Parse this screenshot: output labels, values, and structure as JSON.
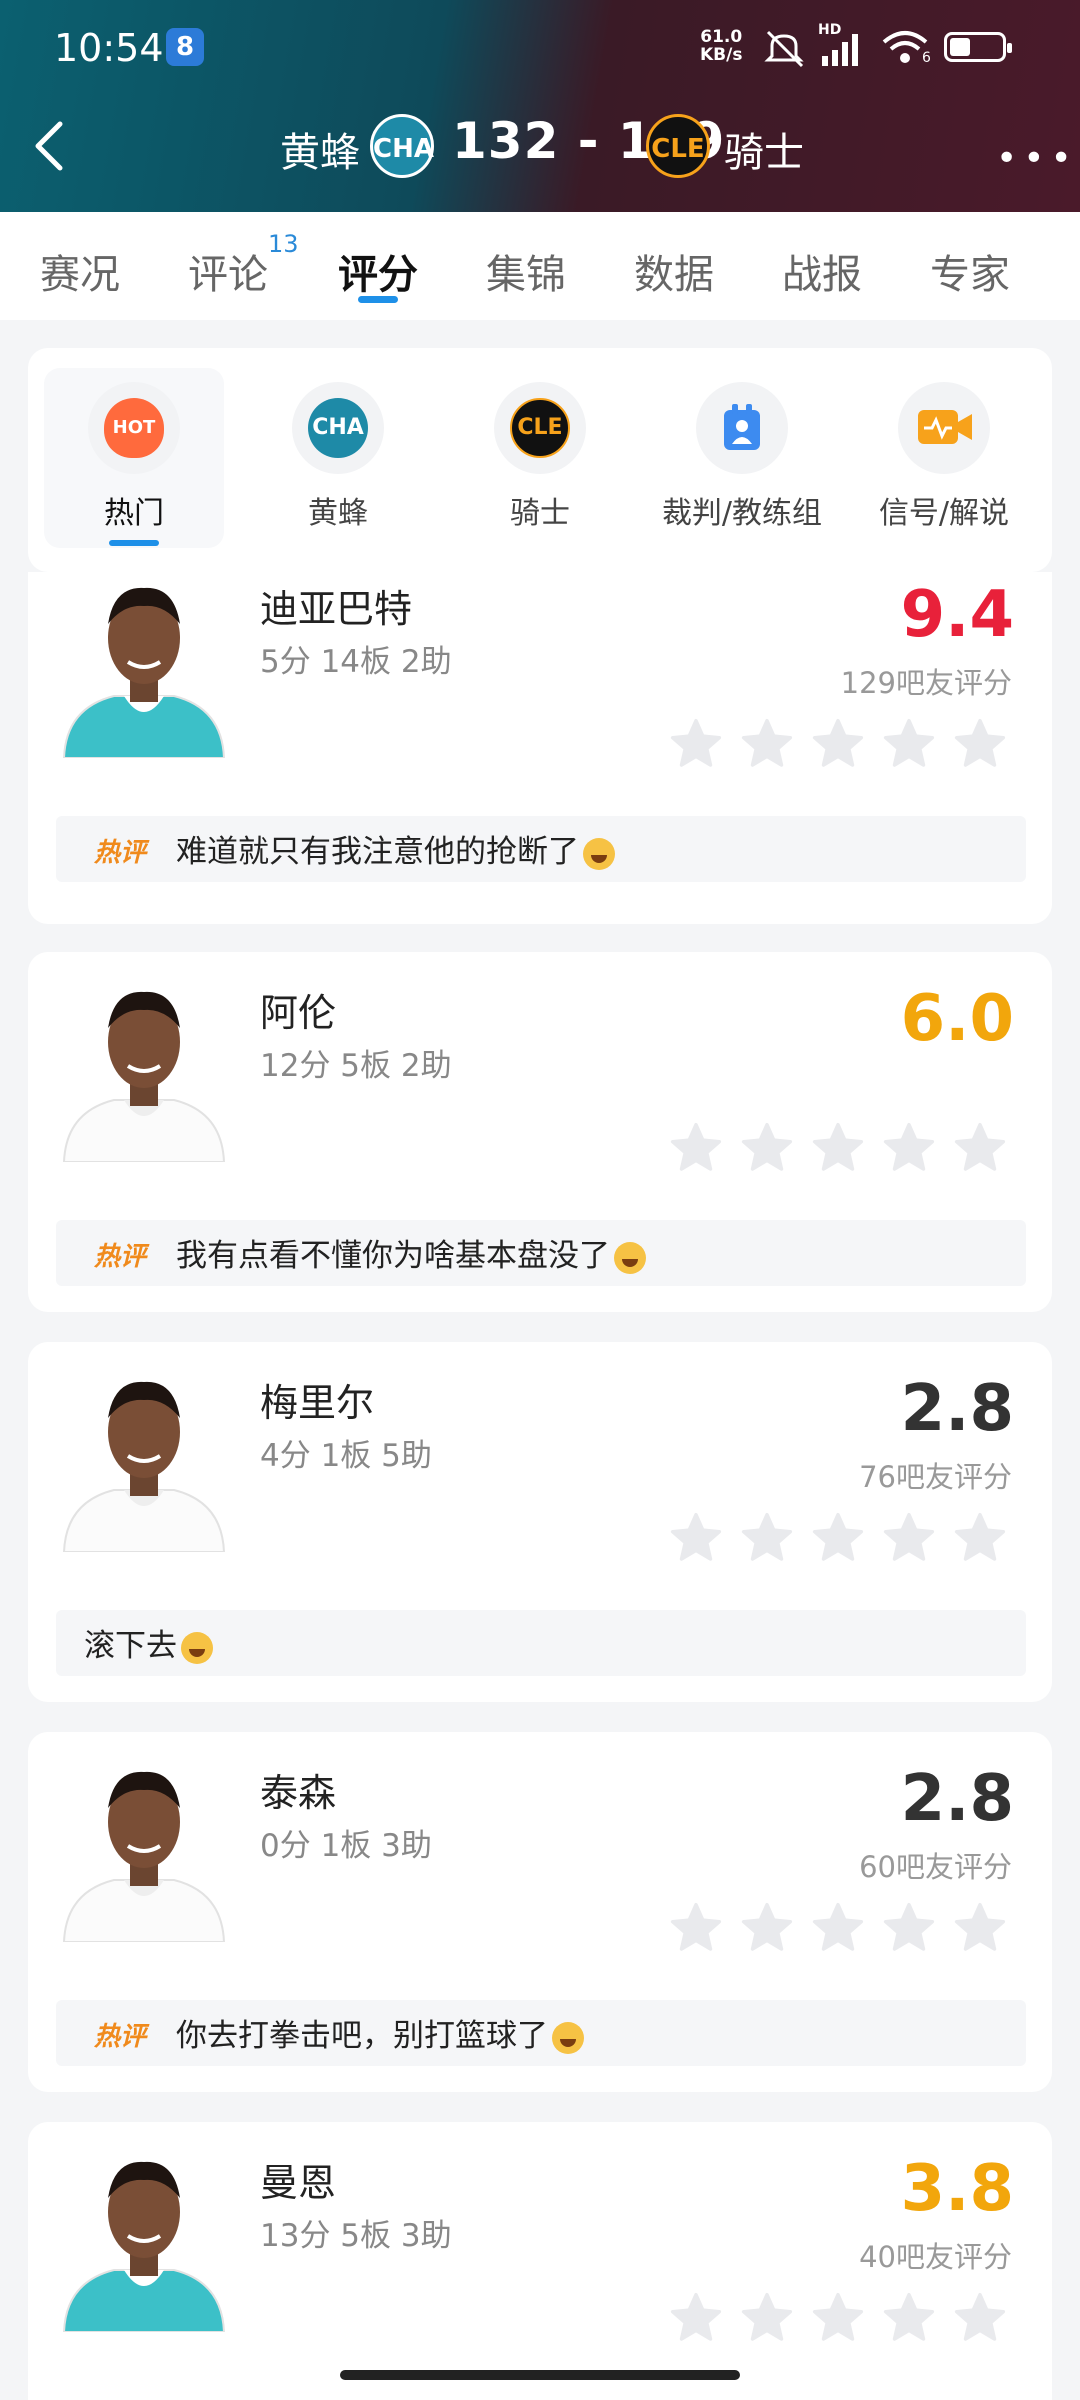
{
  "status_bar": {
    "time": "10:54",
    "notif_badge": "8",
    "speed_value": "61.0",
    "speed_unit": "KB/s",
    "hd_label": "HD",
    "wifi_sub": "6"
  },
  "header": {
    "home_team": "黄蜂",
    "home_abbr": "CHA",
    "score": "132 - 139",
    "away_team": "骑士",
    "away_abbr": "CLE",
    "colors": {
      "left": "#0b6070",
      "right": "#4a1a2a"
    }
  },
  "tabs": [
    {
      "label": "赛况"
    },
    {
      "label": "评论",
      "badge": "13"
    },
    {
      "label": "评分",
      "active": true
    },
    {
      "label": "集锦"
    },
    {
      "label": "数据"
    },
    {
      "label": "战报"
    },
    {
      "label": "专家"
    }
  ],
  "filters": [
    {
      "label": "热门",
      "icon": "hot-icon",
      "icon_text": "HOT",
      "active": true
    },
    {
      "label": "黄蜂",
      "icon": "hornets-logo",
      "icon_text": "CHA"
    },
    {
      "label": "骑士",
      "icon": "cavaliers-logo",
      "icon_text": "CLE"
    },
    {
      "label": "裁判/教练组",
      "icon": "referee-icon"
    },
    {
      "label": "信号/解说",
      "icon": "broadcast-icon"
    }
  ],
  "players": [
    {
      "name": "迪亚巴特",
      "stats": "5分 14板 2助",
      "rating": "9.4",
      "rating_color": "#e8213a",
      "count": "129吧友评分",
      "hot": "热评",
      "comment": "难道就只有我注意他的抢断了",
      "jersey": "teal"
    },
    {
      "name": "阿伦",
      "stats": "12分 5板 2助",
      "rating": "6.0",
      "rating_color": "#f2a60c",
      "count": "",
      "hot": "热评",
      "comment": "我有点看不懂你为啥基本盘没了",
      "jersey": "white"
    },
    {
      "name": "梅里尔",
      "stats": "4分 1板 5助",
      "rating": "2.8",
      "rating_color": "#333333",
      "count": "76吧友评分",
      "hot": "",
      "comment": "滚下去",
      "jersey": "white"
    },
    {
      "name": "泰森",
      "stats": "0分 1板 3助",
      "rating": "2.8",
      "rating_color": "#333333",
      "count": "60吧友评分",
      "hot": "热评",
      "comment": "你去打拳击吧，别打篮球了",
      "jersey": "white"
    },
    {
      "name": "曼恩",
      "stats": "13分 5板 3助",
      "rating": "3.8",
      "rating_color": "#f2a60c",
      "count": "40吧友评分",
      "hot": "",
      "comment": "",
      "jersey": "teal"
    }
  ]
}
